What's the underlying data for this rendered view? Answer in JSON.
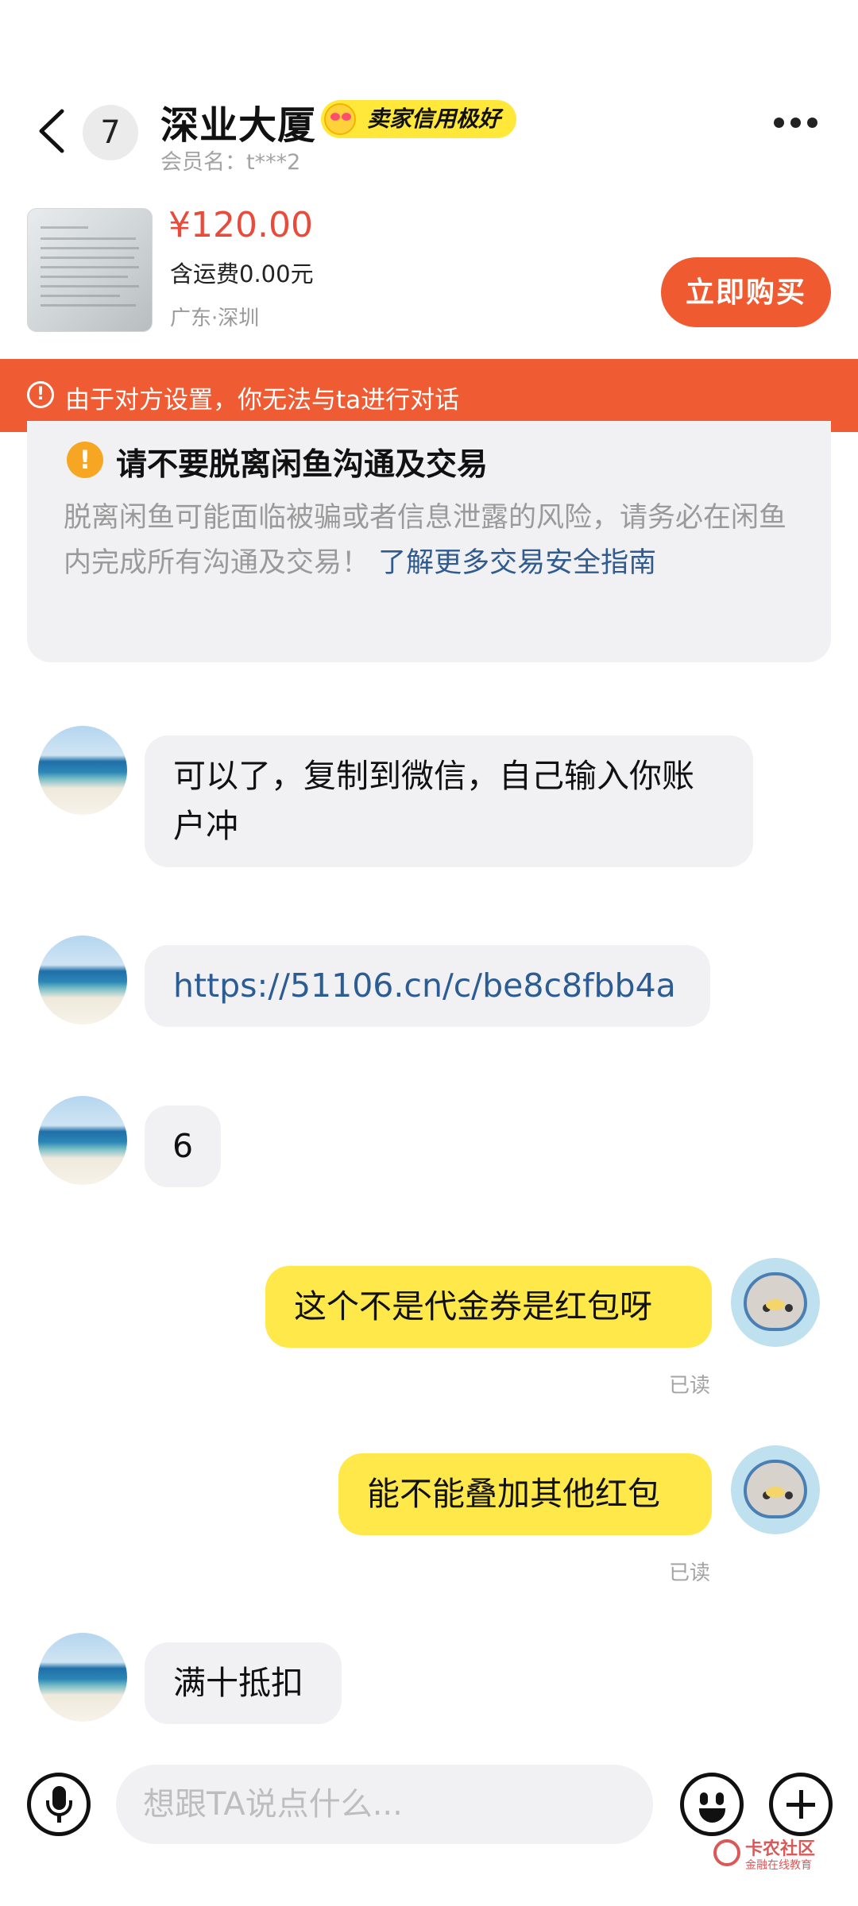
{
  "header": {
    "unread_count": "7",
    "shop_name": "深业大厦",
    "credit_badge": "卖家信用极好",
    "member_name": "会员名：t***2"
  },
  "product": {
    "price": "¥120.00",
    "shipping": "含运费0.00元",
    "location": "广东·深圳",
    "buy_label": "立即购买"
  },
  "notice": {
    "icon": "!",
    "text": "由于对方设置，你无法与ta进行对话"
  },
  "safety": {
    "icon": "!",
    "title": "请不要脱离闲鱼沟通及交易",
    "body": "脱离闲鱼可能面临被骗或者信息泄露的风险，请务必在闲鱼内完成所有沟通及交易！",
    "link": " 了解更多交易安全指南"
  },
  "messages": [
    {
      "side": "in",
      "text": "可以了，复制到微信，自己输入你账户冲"
    },
    {
      "side": "in",
      "text": "https://51106.cn/c/be8c8fbb4a"
    },
    {
      "side": "in",
      "text": "6"
    },
    {
      "side": "out",
      "text": "这个不是代金券是红包呀",
      "status": "已读"
    },
    {
      "side": "out",
      "text": "能不能叠加其他红包",
      "status": "已读"
    },
    {
      "side": "in",
      "text": "满十抵扣"
    }
  ],
  "input": {
    "placeholder": "想跟TA说点什么..."
  },
  "watermark": {
    "name": "卡农社区",
    "tagline": "金融在线教育"
  },
  "colors": {
    "accent_orange": "#ef5b33",
    "price_red": "#e94a3a",
    "bubble_out": "#ffe94a",
    "bubble_in": "#f1f1f3",
    "link_blue": "#2b5c93"
  }
}
